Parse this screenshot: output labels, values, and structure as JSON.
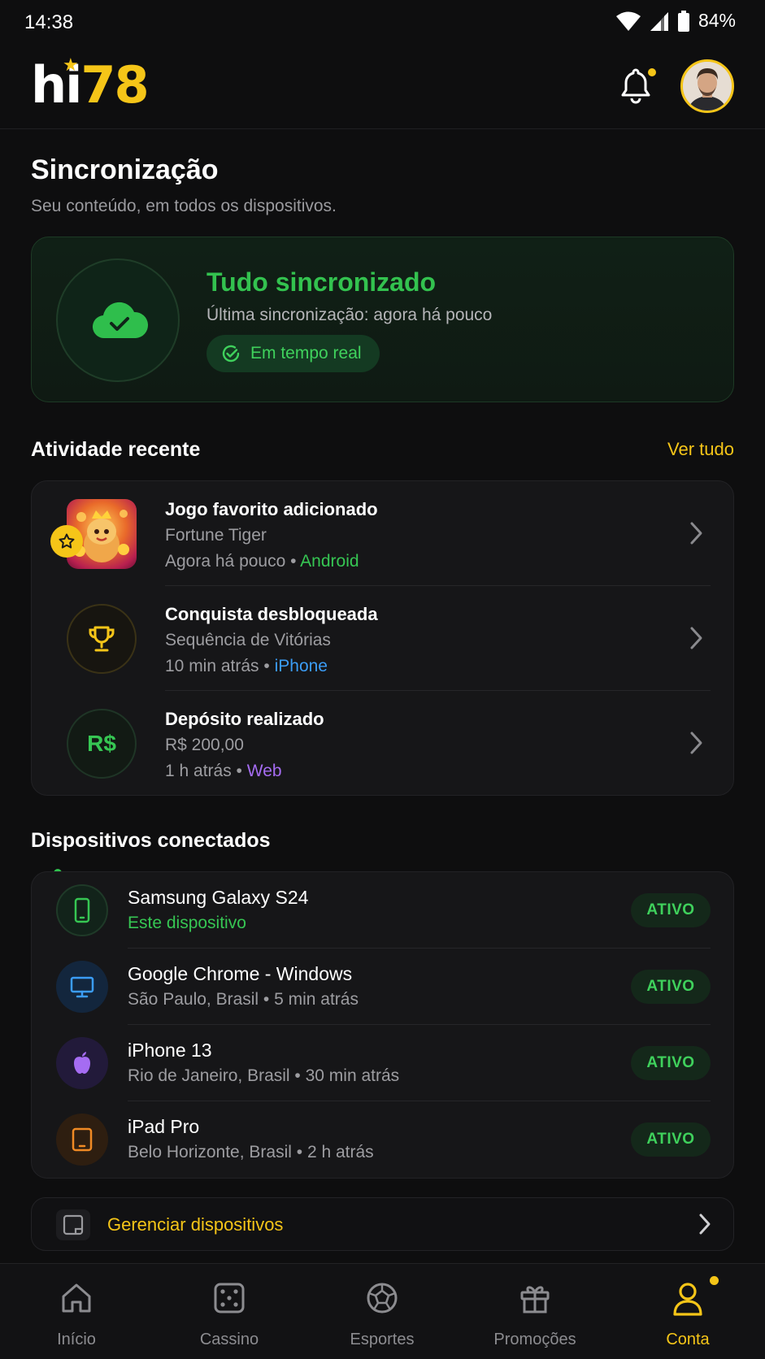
{
  "status_bar": {
    "time": "14:38",
    "battery": "84%"
  },
  "header": {
    "logo_hi": "hi",
    "logo_num": "78"
  },
  "page": {
    "title": "Sincronização",
    "subtitle": "Seu conteúdo, em todos os dispositivos."
  },
  "sync": {
    "title": "Tudo sincronizado",
    "last_sync": "Última sincronização: agora há pouco",
    "pill": "Em tempo real"
  },
  "activity": {
    "heading": "Atividade recente",
    "see_all": "Ver tudo",
    "items": [
      {
        "title": "Jogo favorito adicionado",
        "subtitle": "Fortune Tiger",
        "time": "Agora há pouco",
        "source": "Android",
        "source_color": "#36c653"
      },
      {
        "title": "Conquista desbloqueada",
        "subtitle": "Sequência de Vitórias",
        "time": "10 min atrás",
        "source": "iPhone",
        "source_color": "#3b9cf5"
      },
      {
        "title": "Depósito realizado",
        "subtitle": "R$ 200,00",
        "time": "1 h atrás",
        "source": "Web",
        "source_color": "#a56cf2",
        "icon_text": "R$"
      }
    ]
  },
  "devices": {
    "heading": "Dispositivos conectados",
    "items": [
      {
        "name": "Samsung Galaxy S24",
        "detail": "Este dispositivo",
        "status": "ATIVO"
      },
      {
        "name": "Google Chrome - Windows",
        "detail": "São Paulo, Brasil • 5 min atrás",
        "status": "ATIVO"
      },
      {
        "name": "iPhone 13",
        "detail": "Rio de Janeiro, Brasil • 30 min atrás",
        "status": "ATIVO"
      },
      {
        "name": "iPad Pro",
        "detail": "Belo Horizonte, Brasil • 2 h atrás",
        "status": "ATIVO"
      }
    ],
    "manage_label": "Gerenciar dispositivos"
  },
  "nav": {
    "items": [
      {
        "label": "Início",
        "icon": "home-icon"
      },
      {
        "label": "Cassino",
        "icon": "dice-icon"
      },
      {
        "label": "Esportes",
        "icon": "soccer-ball-icon"
      },
      {
        "label": "Promoções",
        "icon": "gift-icon"
      },
      {
        "label": "Conta",
        "icon": "user-icon",
        "active": true
      }
    ]
  },
  "colors": {
    "accent": "#f5c518",
    "success": "#33c24f",
    "background": "#0e0e0f"
  }
}
